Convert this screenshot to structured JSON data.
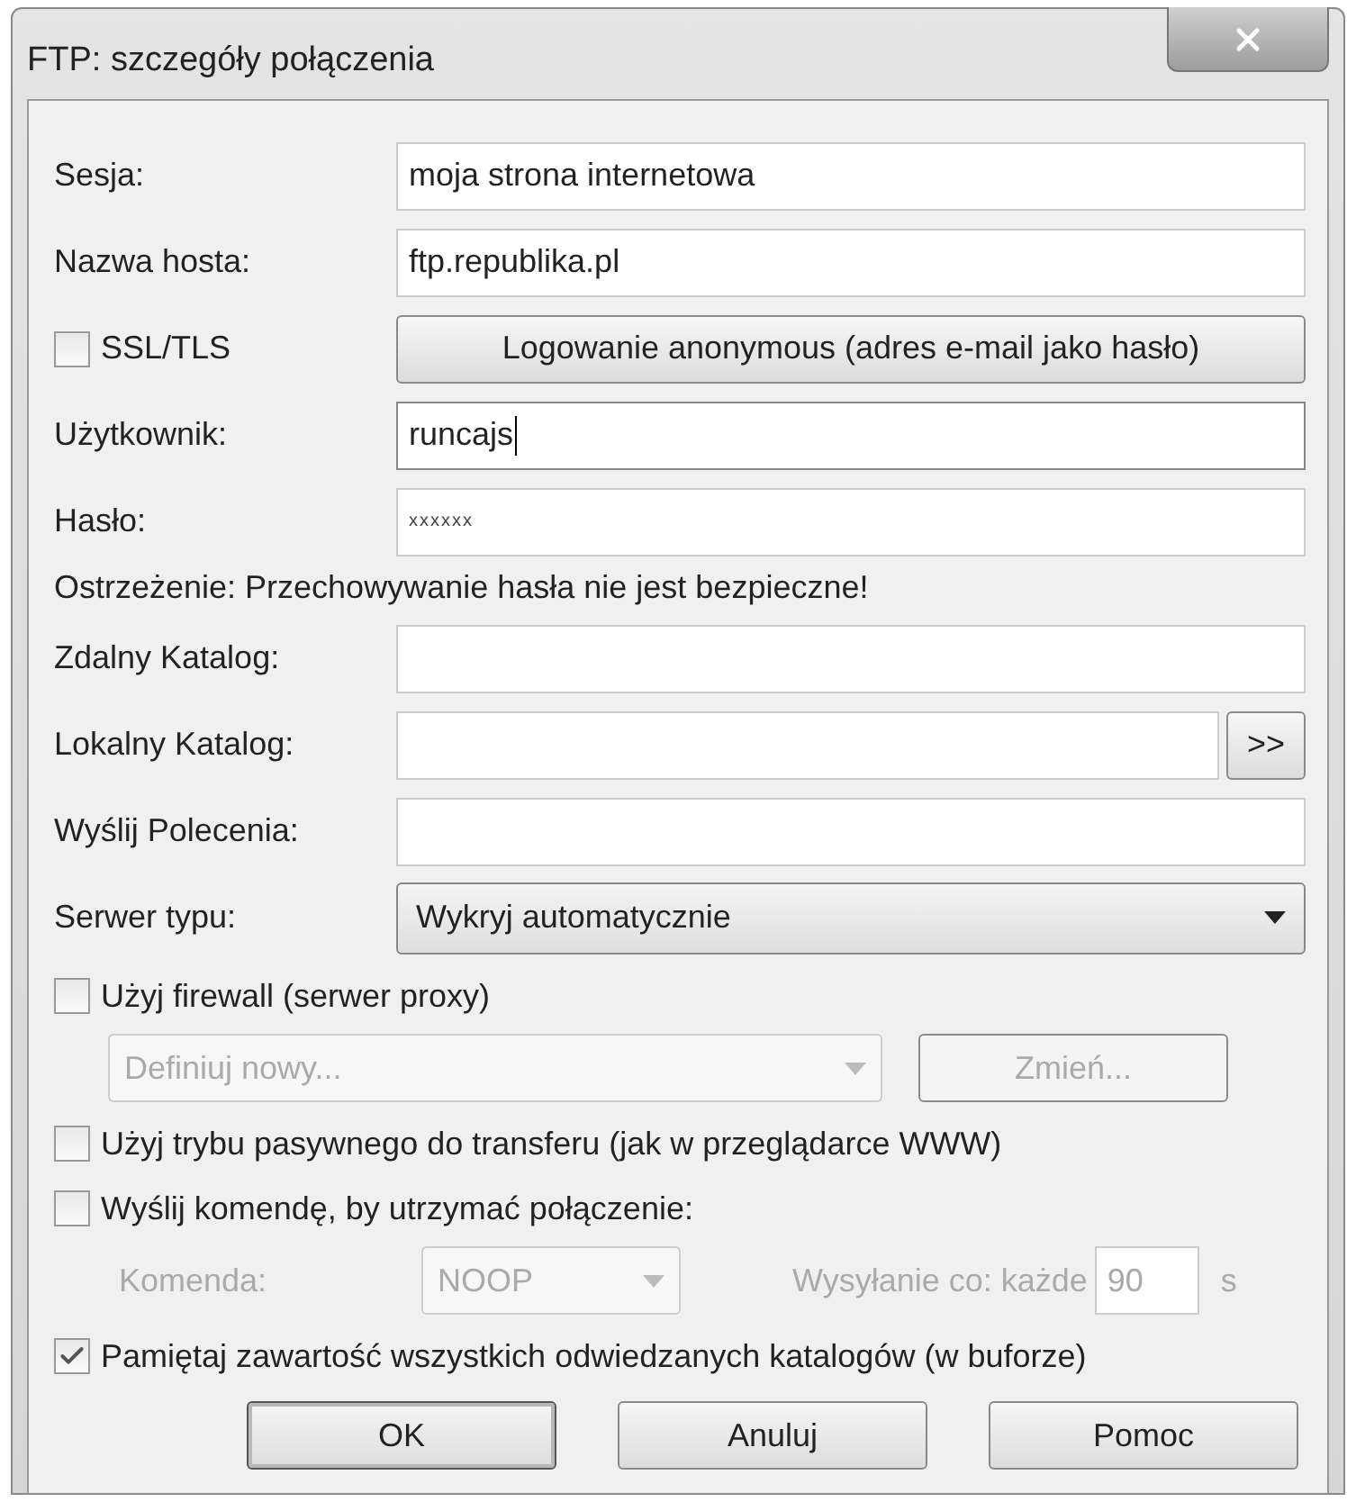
{
  "window": {
    "title": "FTP: szczegóły połączenia"
  },
  "rows": [
    {
      "kind": "text",
      "label": "Sesja:",
      "value": "moja strona internetowa",
      "focused": false
    },
    {
      "kind": "text",
      "label": "Nazwa hosta:",
      "value": "ftp.republika.pl",
      "focused": false
    },
    {
      "kind": "check_button",
      "label": "SSL/TLS",
      "checked": false,
      "button": "Logowanie anonymous (adres e-mail jako hasło)"
    },
    {
      "kind": "text",
      "label": "Użytkownik:",
      "value": "runcajs",
      "focused": true
    },
    {
      "kind": "password",
      "label": "Hasło:",
      "value": "xxxxxx"
    },
    {
      "kind": "note",
      "text": "Ostrzeżenie: Przechowywanie hasła nie jest bezpieczne!"
    },
    {
      "kind": "text",
      "label": "Zdalny Katalog:",
      "focused": false
    },
    {
      "kind": "browse",
      "label": "Lokalny Katalog:",
      "button": ">>"
    },
    {
      "kind": "text",
      "label": "Wyślij Polecenia:",
      "focused": false
    },
    {
      "kind": "select",
      "label": "Serwer typu:",
      "value": "Wykryj automatycznie"
    }
  ],
  "firewall": {
    "label": "Użyj firewall (serwer proxy)",
    "checked": false,
    "proxy": "Definiuj nowy...",
    "change_button": "Zmień...",
    "disabled": true
  },
  "passive": {
    "label": "Użyj trybu pasywnego do transferu (jak w przeglądarce WWW)",
    "checked": false
  },
  "keepalive": {
    "label": "Wyślij komendę, by utrzymać połączenie:",
    "checked": false,
    "command_label": "Komenda:",
    "command": "NOOP",
    "interval_label": "Wysyłanie co: każde",
    "interval": "90",
    "unit": "s",
    "disabled": true
  },
  "cache": {
    "label": "Pamiętaj zawartość wszystkich odwiedzanych katalogów (w buforze)",
    "checked": true
  },
  "buttons": [
    {
      "label": "OK",
      "default": true
    },
    {
      "label": "Anuluj",
      "default": false
    },
    {
      "label": "Pomoc",
      "default": false
    }
  ]
}
